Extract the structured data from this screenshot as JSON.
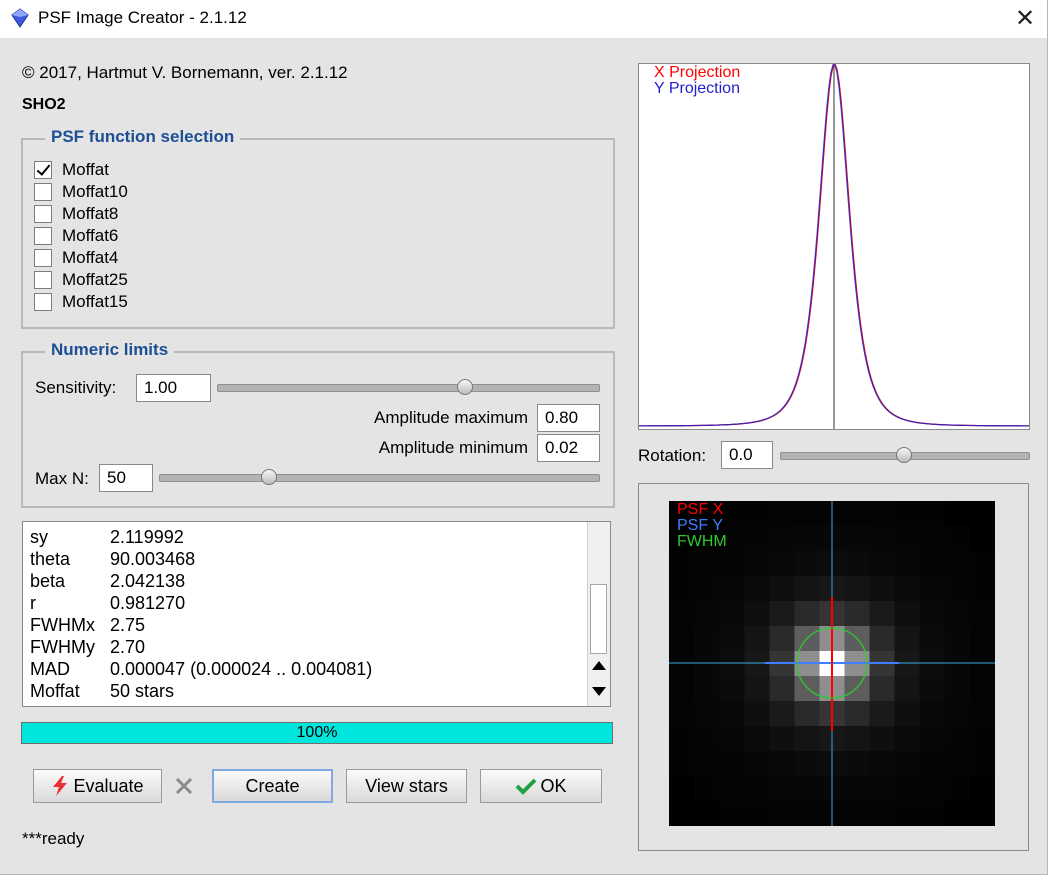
{
  "window": {
    "title": "PSF Image Creator - 2.1.12",
    "close_glyph": "✕"
  },
  "header": {
    "copyright": "© 2017, Hartmut V. Bornemann, ver. 2.1.12",
    "image_name": "SHO2"
  },
  "psf_selection": {
    "legend": "PSF function selection",
    "options": [
      {
        "label": "Moffat",
        "checked": true
      },
      {
        "label": "Moffat10",
        "checked": false
      },
      {
        "label": "Moffat8",
        "checked": false
      },
      {
        "label": "Moffat6",
        "checked": false
      },
      {
        "label": "Moffat4",
        "checked": false
      },
      {
        "label": "Moffat25",
        "checked": false
      },
      {
        "label": "Moffat15",
        "checked": false
      }
    ]
  },
  "numeric_limits": {
    "legend": "Numeric limits",
    "sensitivity_label": "Sensitivity:",
    "sensitivity_value": "1.00",
    "sensitivity_slider_level": 0.65,
    "amp_max_label": "Amplitude maximum",
    "amp_max_value": "0.80",
    "amp_min_label": "Amplitude minimum",
    "amp_min_value": "0.02",
    "max_n_label": "Max N:",
    "max_n_value": "50",
    "max_n_slider_level": 0.25
  },
  "results": [
    {
      "key": "sy",
      "value": "2.119992"
    },
    {
      "key": "theta",
      "value": "90.003468"
    },
    {
      "key": "beta",
      "value": "2.042138"
    },
    {
      "key": "r",
      "value": "0.981270"
    },
    {
      "key": "FWHMx",
      "value": "2.75"
    },
    {
      "key": "FWHMy",
      "value": "2.70"
    },
    {
      "key": "MAD",
      "value": "0.000047 (0.000024 .. 0.004081)"
    },
    {
      "key": "Moffat",
      "value": "50 stars"
    }
  ],
  "progress": {
    "percent": 100,
    "label": "100%"
  },
  "buttons": {
    "evaluate": "Evaluate",
    "create": "Create",
    "view_stars": "View stars",
    "ok": "OK"
  },
  "status": "***ready",
  "projection_plot": {
    "legend_x": "X Projection",
    "legend_y": "Y Projection",
    "color_x": "#ff0000",
    "color_y": "#2323c8"
  },
  "rotation": {
    "label": "Rotation:",
    "value": "0.0",
    "slider_level": 0.5
  },
  "psf_image": {
    "legend_psf_x": "PSF X",
    "legend_psf_y": "PSF Y",
    "legend_fwhm": "FWHM",
    "color_psf_x": "#ff0000",
    "color_psf_y": "#3f7fff",
    "color_fwhm": "#2ec82e"
  },
  "icons": {
    "app": "diamond-icon",
    "evaluate": "lightning-icon",
    "cancel": "x-icon",
    "ok": "checkmark-icon",
    "scroll_up": "arrow-up-icon",
    "scroll_down": "arrow-down-icon"
  }
}
